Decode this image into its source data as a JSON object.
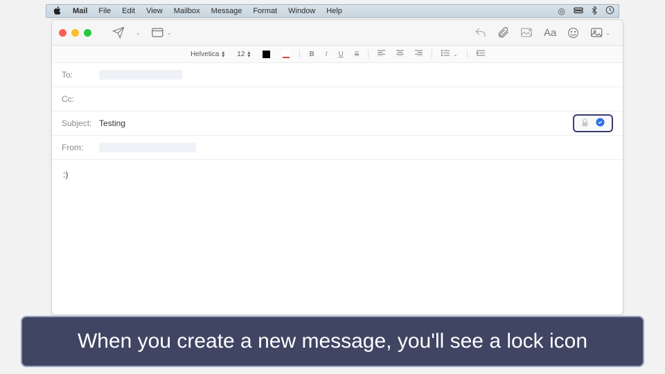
{
  "menubar": {
    "app": "Mail",
    "items": [
      "File",
      "Edit",
      "View",
      "Mailbox",
      "Message",
      "Format",
      "Window",
      "Help"
    ]
  },
  "toolbar": {},
  "formatbar": {
    "font": "Helvetica",
    "size": "12"
  },
  "headers": {
    "to_label": "To:",
    "cc_label": "Cc:",
    "subject_label": "Subject:",
    "subject_value": "Testing",
    "from_label": "From:"
  },
  "body": ":)",
  "caption": "When you create a new message, you'll see a lock icon"
}
